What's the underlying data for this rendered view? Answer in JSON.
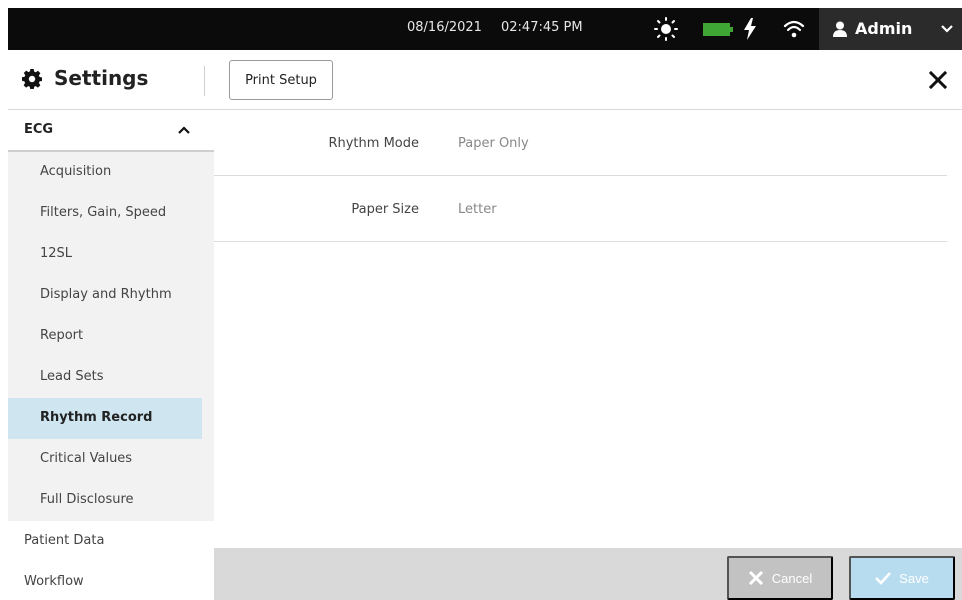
{
  "statusbar": {
    "date": "08/16/2021",
    "time": "02:47:45 PM",
    "user": "Admin",
    "icons": [
      "sun-icon",
      "battery-icon",
      "charging-bolt-icon",
      "wifi-icon",
      "user-icon",
      "chevron-down-icon"
    ]
  },
  "header": {
    "title": "Settings",
    "print_setup": "Print Setup"
  },
  "sidebar": {
    "section": "ECG",
    "items": [
      {
        "label": "Acquisition"
      },
      {
        "label": "Filters, Gain, Speed"
      },
      {
        "label": "12SL"
      },
      {
        "label": "Display and Rhythm"
      },
      {
        "label": "Report"
      },
      {
        "label": "Lead Sets"
      },
      {
        "label": "Rhythm Record",
        "active": true
      },
      {
        "label": "Critical Values"
      },
      {
        "label": "Full Disclosure"
      }
    ],
    "top_items": [
      {
        "label": "Patient Data"
      },
      {
        "label": "Workflow"
      }
    ]
  },
  "content": {
    "rows": [
      {
        "label": "Rhythm Mode",
        "value": "Paper Only"
      },
      {
        "label": "Paper Size",
        "value": "Letter"
      }
    ]
  },
  "footer": {
    "cancel": "Cancel",
    "save": "Save"
  },
  "colors": {
    "statusbar_bg": "#0b0b0b",
    "battery_green": "#3fa535",
    "active_item_bg": "#cfe6f1",
    "save_disabled": "#b8dcef",
    "cancel_disabled": "#c2c2c2"
  }
}
